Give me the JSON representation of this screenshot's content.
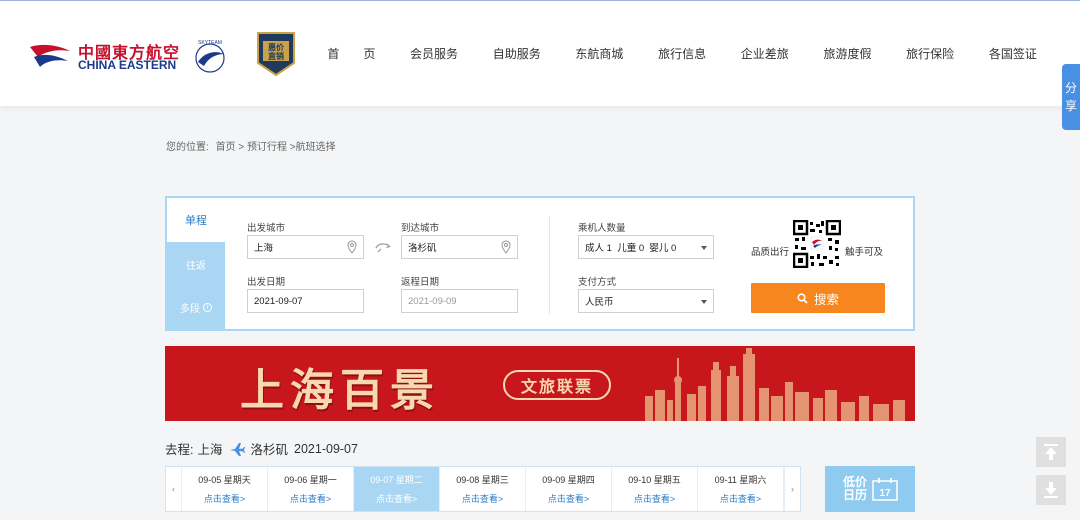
{
  "header": {
    "logo_cn": "中國東方航空",
    "logo_en": "CHINA EASTERN",
    "skyteam_text": "SKYTEAM",
    "badge_text": "惠价直销",
    "nav": [
      "首　　页",
      "会员服务",
      "自助服务",
      "东航商城",
      "旅行信息",
      "企业差旅",
      "旅游度假",
      "旅行保险",
      "各国签证"
    ]
  },
  "share": {
    "line1": "分",
    "line2": "享"
  },
  "breadcrumb": {
    "label": "您的位置:",
    "path": "首页 > 预订行程 >航班选择"
  },
  "tabs": {
    "oneway": "单程",
    "roundtrip": "往返",
    "multi": "多段",
    "info_icon": "i"
  },
  "form": {
    "from_label": "出发城市",
    "from_value": "上海",
    "to_label": "到达城市",
    "to_value": "洛杉矶",
    "depart_label": "出发日期",
    "depart_value": "2021-09-07",
    "return_label": "返程日期",
    "return_placeholder": "2021-09-09",
    "pax_label": "乘机人数量",
    "pax_value": "成人 1  儿童 0  婴儿 0",
    "pay_label": "支付方式",
    "pay_value": "人民币",
    "qr_left": "品质出行",
    "qr_right": "触手可及",
    "search_label": "搜索"
  },
  "banner": {
    "title": "上海百景",
    "pill": "文旅联票"
  },
  "route": {
    "prefix": "去程:",
    "from": "上海",
    "to": "洛杉矶",
    "date": "2021-09-07"
  },
  "dates": [
    {
      "date": "09-05 星期天",
      "link": "点击查看>",
      "active": false
    },
    {
      "date": "09-06 星期一",
      "link": "点击查看>",
      "active": false
    },
    {
      "date": "09-07 星期二",
      "link": "点击查看>",
      "active": true
    },
    {
      "date": "09-08 星期三",
      "link": "点击查看>",
      "active": false
    },
    {
      "date": "09-09 星期四",
      "link": "点击查看>",
      "active": false
    },
    {
      "date": "09-10 星期五",
      "link": "点击查看>",
      "active": false
    },
    {
      "date": "09-11 星期六",
      "link": "点击查看>",
      "active": false
    }
  ],
  "date_nav": {
    "prev": "‹",
    "next": "›"
  },
  "calendar": {
    "label": "低价日历",
    "day": "17"
  },
  "colors": {
    "accent": "#f7861e",
    "panel_border": "#a9d6f2",
    "brand_red": "#c8102e",
    "link_blue": "#2a7cc7"
  }
}
